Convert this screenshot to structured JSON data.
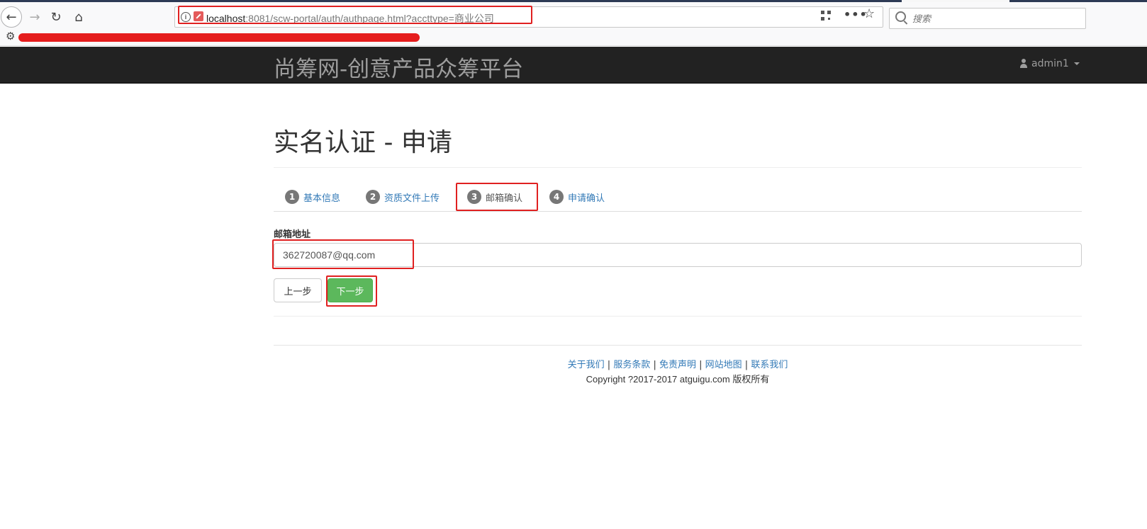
{
  "browser": {
    "url_host": "localhost",
    "url_rest": ":8081/scw-portal/auth/authpage.html?accttype=商业公司",
    "search_placeholder": "搜索"
  },
  "header": {
    "brand": "尚筹网-创意产品众筹平台",
    "user": "admin1"
  },
  "page": {
    "title": "实名认证 - 申请",
    "tabs": [
      {
        "num": "1",
        "label": "基本信息"
      },
      {
        "num": "2",
        "label": "资质文件上传"
      },
      {
        "num": "3",
        "label": "邮箱确认"
      },
      {
        "num": "4",
        "label": "申请确认"
      }
    ],
    "active_tab": 3,
    "email_label": "邮箱地址",
    "email_value": "362720087@qq.com",
    "prev_label": "上一步",
    "next_label": "下一步"
  },
  "footer": {
    "links": [
      "关于我们",
      "服务条款",
      "免责声明",
      "网站地图",
      "联系我们"
    ],
    "copyright": "Copyright ?2017-2017 atguigu.com 版权所有"
  },
  "colors": {
    "header_bg": "#222222",
    "link": "#337ab7",
    "success": "#5cb85c",
    "highlight": "#e02020"
  }
}
